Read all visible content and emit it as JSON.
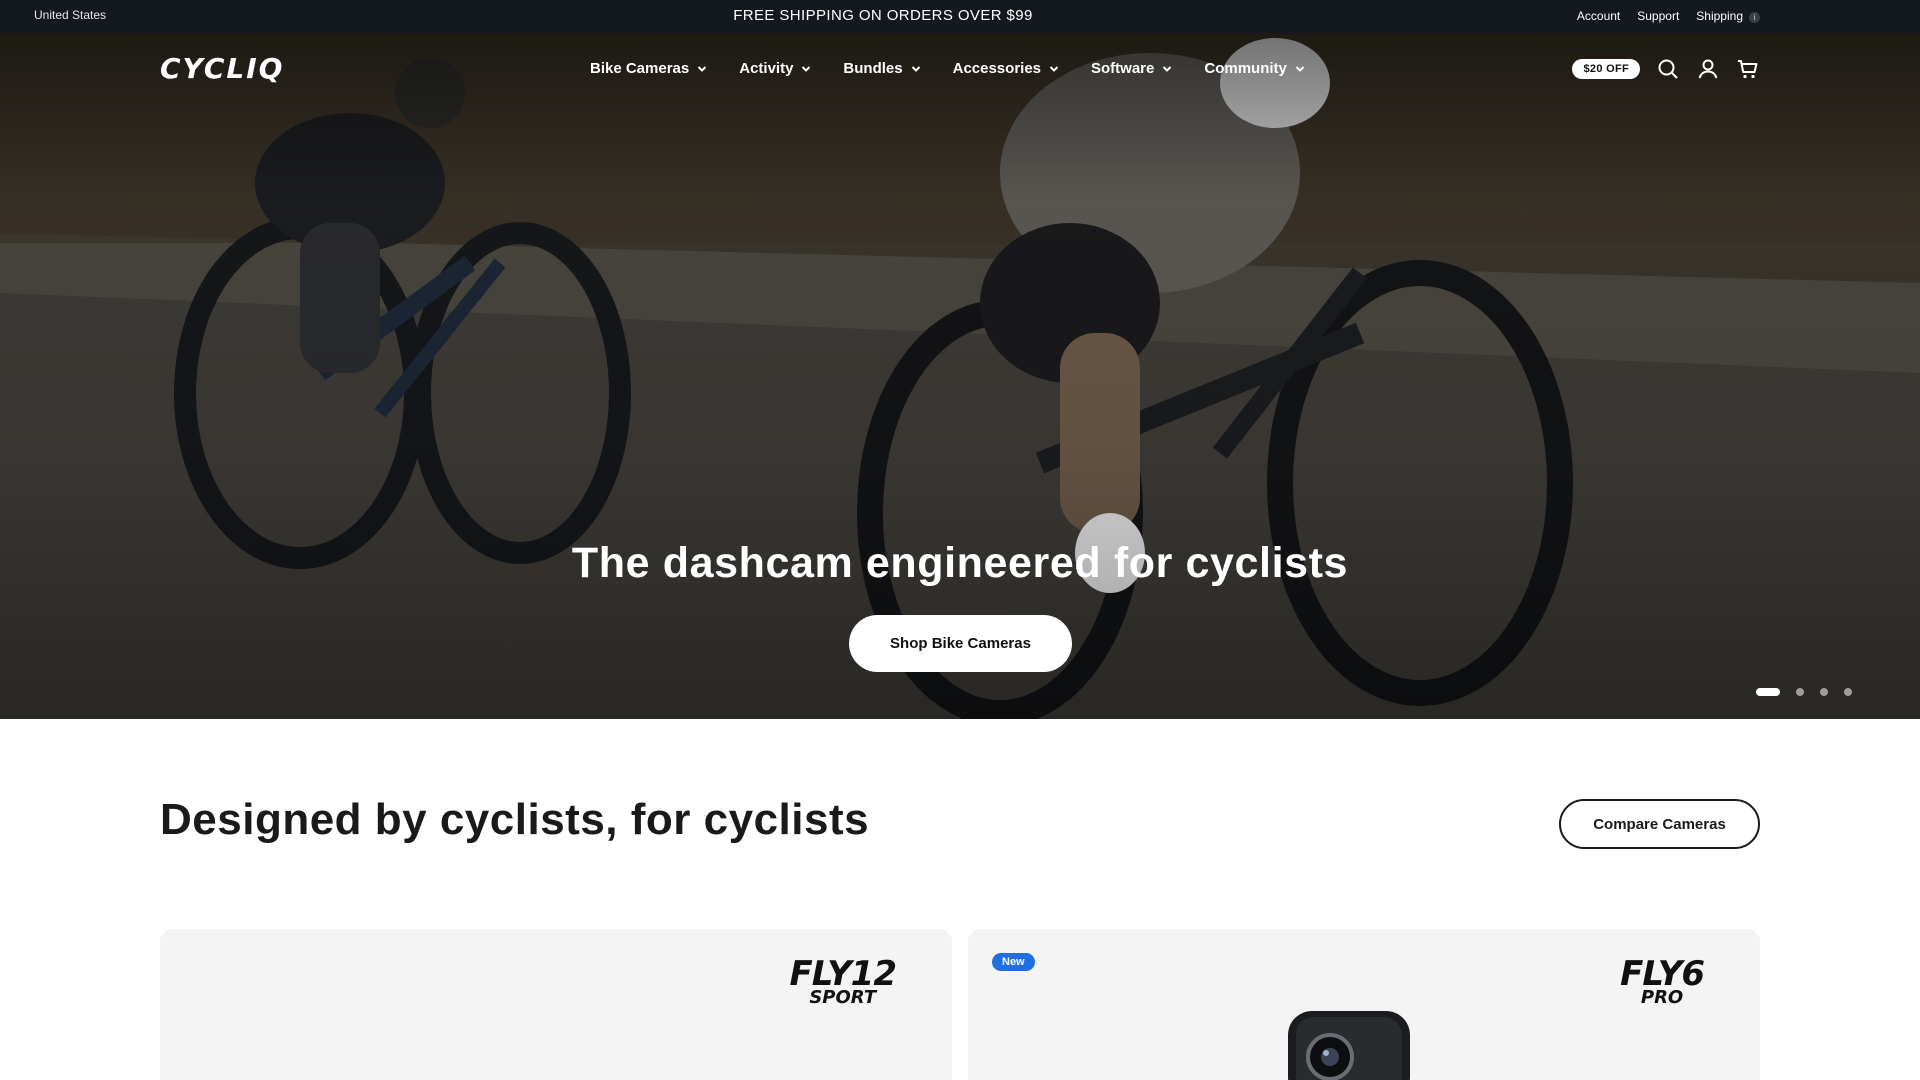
{
  "announcement": {
    "country": "United States",
    "promo": "FREE SHIPPING ON ORDERS OVER $99",
    "links": [
      "Account",
      "Support",
      "Shipping"
    ],
    "info_glyph": "i"
  },
  "header": {
    "logo": "CYCLIQ",
    "nav": [
      {
        "label": "Bike Cameras"
      },
      {
        "label": "Activity"
      },
      {
        "label": "Bundles"
      },
      {
        "label": "Accessories"
      },
      {
        "label": "Software"
      },
      {
        "label": "Community"
      }
    ],
    "badge": "$20 OFF",
    "icons": [
      "search-icon",
      "account-icon",
      "cart-icon"
    ]
  },
  "hero": {
    "title": "The dashcam engineered for cyclists",
    "cta": "Shop Bike Cameras",
    "slides_total": 4,
    "active_slide": 1
  },
  "section": {
    "title": "Designed by cyclists, for cyclists",
    "compare_button": "Compare Cameras"
  },
  "products": [
    {
      "brand_main": "FLY12",
      "brand_sub": "SPORT",
      "badge": ""
    },
    {
      "brand_main": "FLY6",
      "brand_sub": "PRO",
      "badge": "New"
    }
  ],
  "colors": {
    "topbar": "#14191f",
    "new_badge": "#1f6fe0",
    "card_bg": "#f4f4f4"
  }
}
